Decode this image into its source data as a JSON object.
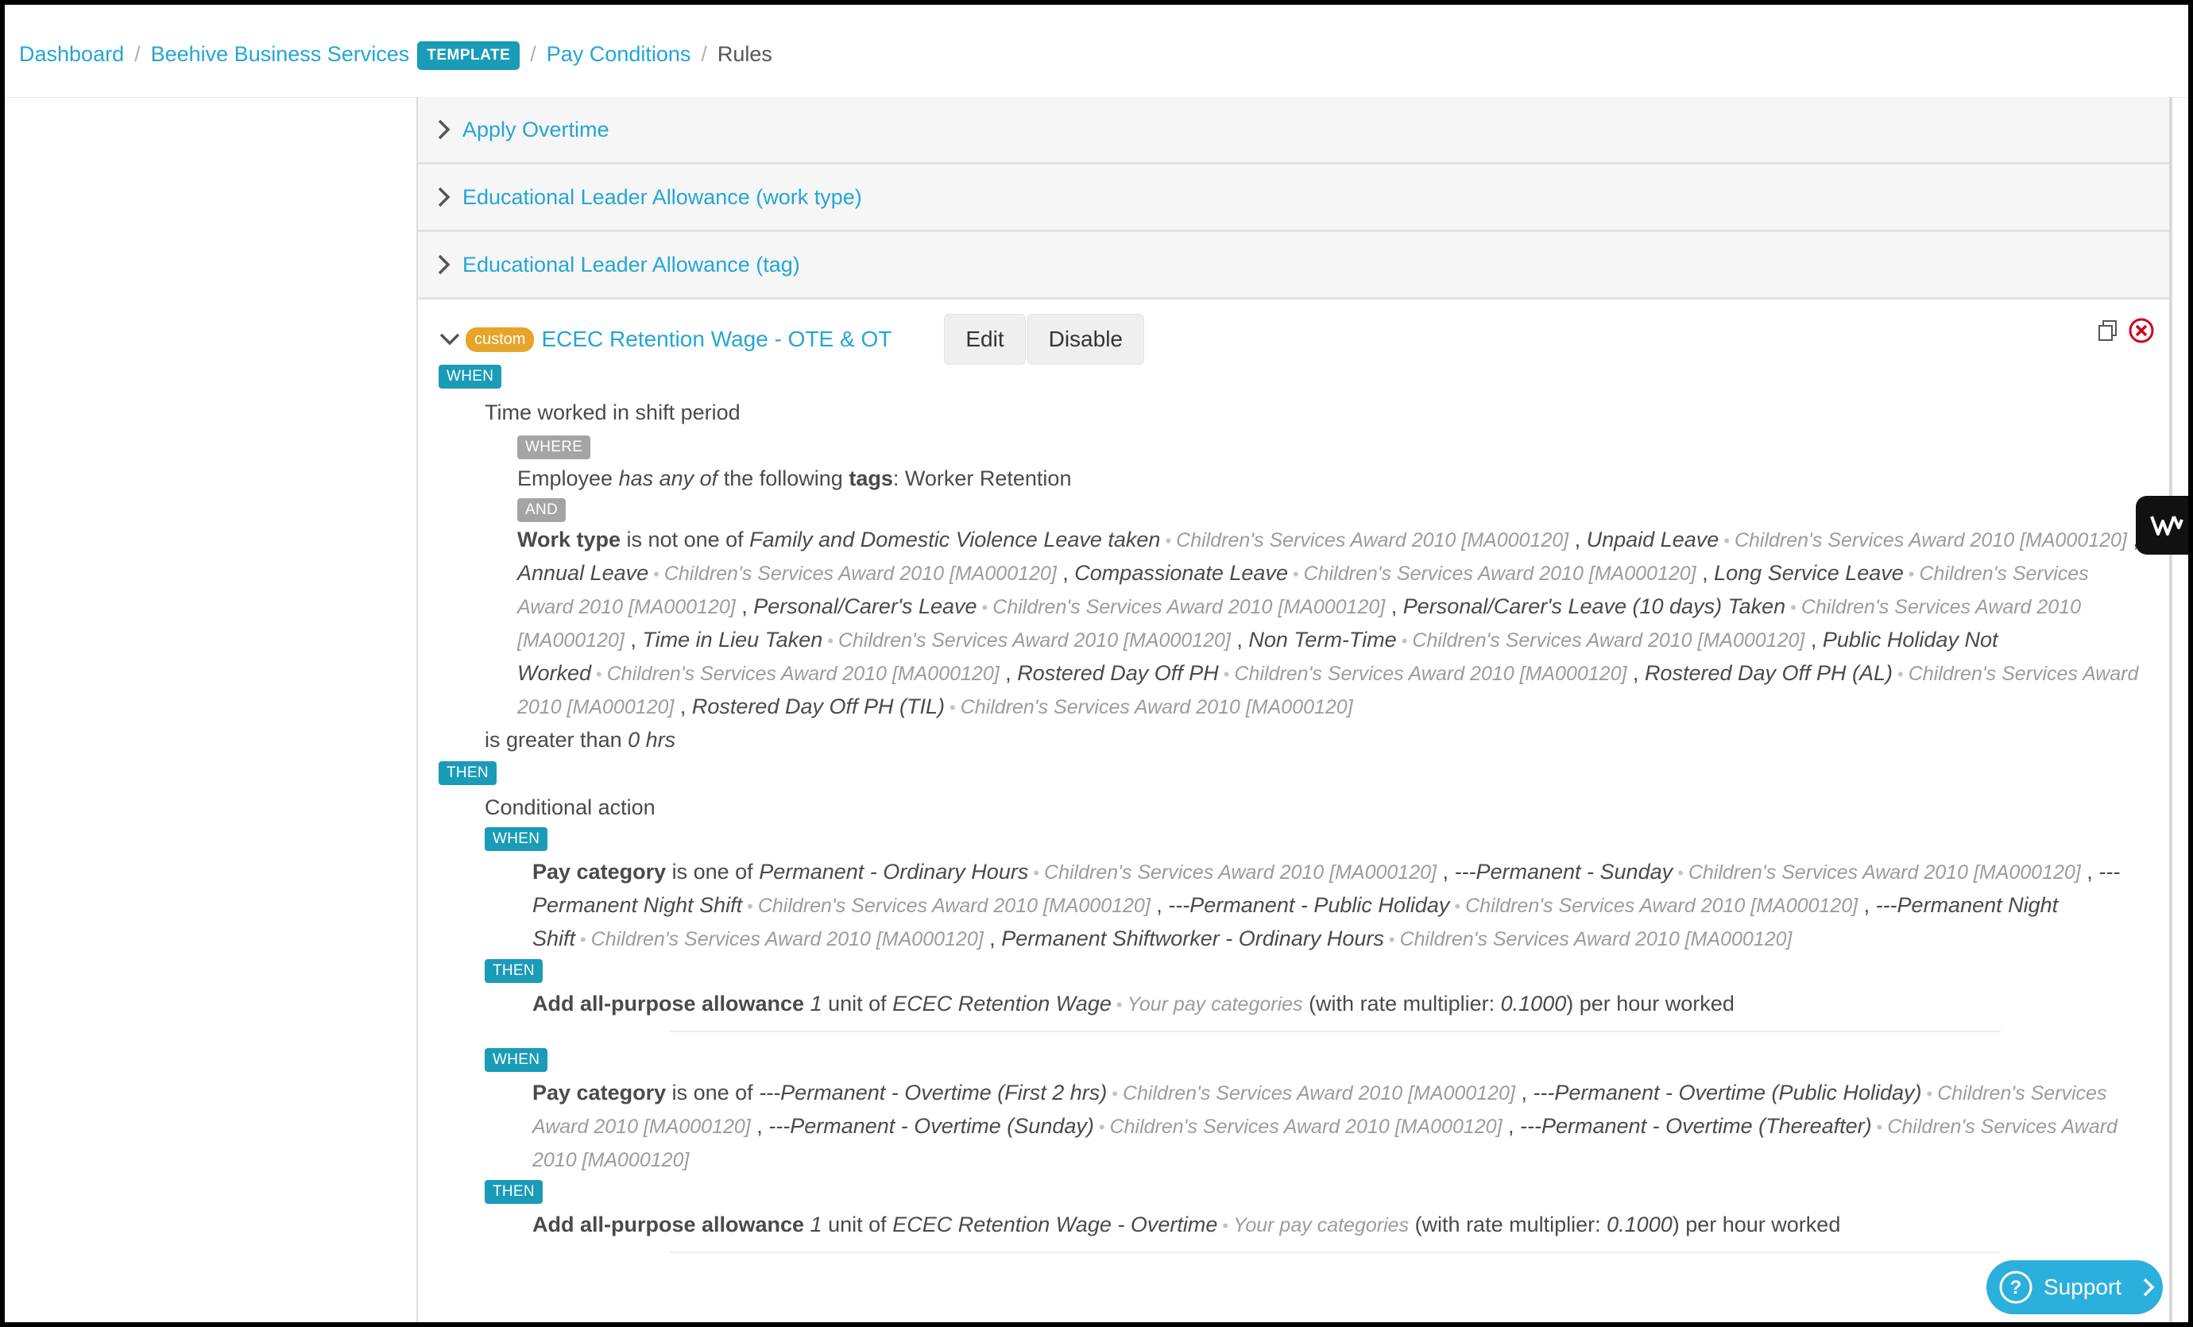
{
  "breadcrumb": {
    "items": [
      "Dashboard",
      "Beehive Business Services",
      "Pay Conditions"
    ],
    "template_badge": "TEMPLATE",
    "current": "Rules"
  },
  "rules_collapsed": [
    {
      "name": "Apply Overtime"
    },
    {
      "name": "Educational Leader Allowance (work type)"
    },
    {
      "name": "Educational Leader Allowance (tag)"
    }
  ],
  "open_rule": {
    "custom_badge": "custom",
    "name": "ECEC Retention Wage - OTE & OT",
    "edit_label": "Edit",
    "disable_label": "Disable",
    "when_tag": "WHEN",
    "then_tag": "THEN",
    "where_tag": "WHERE",
    "and_tag": "AND",
    "time_worked": "Time worked in shift period",
    "where_line": {
      "prefix": "Employee",
      "has_any_of": "has any of",
      "middle": "the following",
      "tags_word": "tags",
      "value": ": Worker Retention"
    },
    "worktype": {
      "label": "Work type",
      "operator": "is not one of",
      "award": "Children's Services Award 2010 [MA000120]",
      "items": [
        "Family and Domestic Violence Leave taken",
        "Unpaid Leave",
        "Annual Leave",
        "Compassionate Leave",
        "Long Service Leave",
        "Personal/Carer's Leave",
        "Personal/Carer's Leave (10 days) Taken",
        "Time in Lieu Taken",
        "Non Term-Time",
        "Public Holiday Not Worked",
        "Rostered Day Off PH",
        "Rostered Day Off PH (AL)",
        "Rostered Day Off PH (TIL)"
      ]
    },
    "greater_than": "is greater than",
    "zero_hrs": "0 hrs",
    "conditional_action": "Conditional action",
    "branches": [
      {
        "pay_label": "Pay category",
        "operator": "is one of",
        "items": [
          "Permanent - Ordinary Hours",
          "---Permanent - Sunday",
          "---Permanent Night Shift",
          "---Permanent - Public Holiday",
          "---Permanent Night Shift",
          "Permanent Shiftworker - Ordinary Hours"
        ],
        "action_label": "Add all-purpose allowance",
        "units": "1",
        "unit_of": "unit of",
        "allowance": "ECEC Retention Wage",
        "source": "Your pay categories",
        "multiplier_prefix": "(with rate multiplier:",
        "multiplier": "0.1000",
        "suffix": ") per hour worked"
      },
      {
        "pay_label": "Pay category",
        "operator": "is one of",
        "items": [
          "---Permanent - Overtime (First 2 hrs)",
          "---Permanent - Overtime (Public Holiday)",
          "---Permanent - Overtime (Sunday)",
          "---Permanent - Overtime (Thereafter)"
        ],
        "action_label": "Add all-purpose allowance",
        "units": "1",
        "unit_of": "unit of",
        "allowance": "ECEC Retention Wage - Overtime",
        "source": "Your pay categories",
        "multiplier_prefix": "(with rate multiplier:",
        "multiplier": "0.1000",
        "suffix": ") per hour worked"
      }
    ]
  },
  "widgets": {
    "support_label": "Support"
  },
  "colors": {
    "link": "#23a6d5",
    "tag_blue": "#1a9bb8",
    "tag_gray": "#a4a4a4",
    "custom_badge": "#e6a42a",
    "support_bg": "#2bb0dd"
  }
}
